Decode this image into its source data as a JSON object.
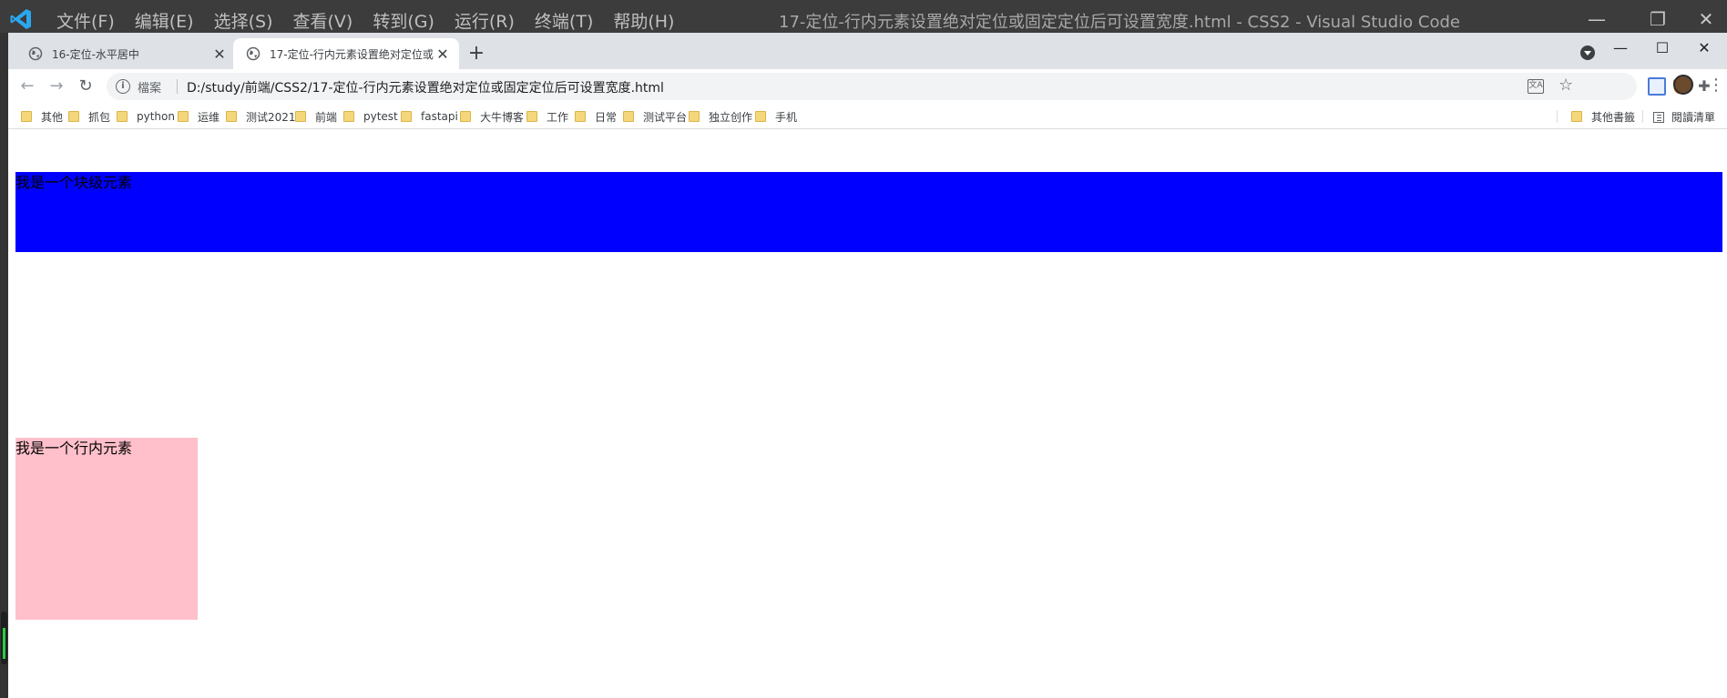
{
  "vscode": {
    "menu": [
      "文件(F)",
      "编辑(E)",
      "选择(S)",
      "查看(V)",
      "转到(G)",
      "运行(R)",
      "终端(T)",
      "帮助(H)"
    ],
    "title": "17-定位-行内元素设置绝对定位或固定定位后可设置宽度.html - CSS2 - Visual Studio Code",
    "window_controls": {
      "minimize": "—",
      "restore": "❐",
      "close": "✕"
    }
  },
  "browser": {
    "tabs": [
      {
        "label": "16-定位-水平居中",
        "active": false,
        "close": "✕"
      },
      {
        "label": "17-定位-行内元素设置绝对定位或固定定位后可设置宽度",
        "active": true,
        "close": "✕"
      }
    ],
    "new_tab": "+",
    "window_controls": {
      "minimize": "—",
      "maximize": "☐",
      "close": "✕"
    },
    "nav": {
      "back": "←",
      "forward": "→",
      "reload": "↻"
    },
    "address": {
      "chip": "檔案",
      "url": "D:/study/前端/CSS2/17-定位-行内元素设置绝对定位或固定定位后可设置宽度.html"
    },
    "bookmarks": [
      "其他",
      "抓包",
      "python",
      "运维",
      "测试2021",
      "前端",
      "pytest",
      "fastapi",
      "大牛博客",
      "工作",
      "日常",
      "测试平台",
      "独立创作",
      "手机"
    ],
    "other_bookmarks": "其他書籤",
    "reading_list": "閱讀清單"
  },
  "page": {
    "block": {
      "text": "我是一个块级元素",
      "color": "#0000ff"
    },
    "inline": {
      "text": "我是一个行内元素",
      "color": "#ffc0cb"
    }
  },
  "colors": {
    "vscode_titlebar": "#3c3c3c",
    "tabstrip": "#dee1e6",
    "omnibox": "#f1f3f4"
  }
}
